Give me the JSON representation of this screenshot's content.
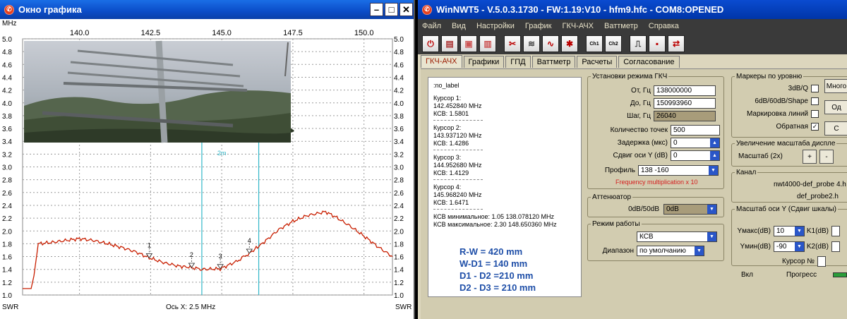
{
  "graph_window": {
    "title": "Окно графика",
    "x_unit": "MHz",
    "x_ticks": [
      "140.0",
      "142.5",
      "145.0",
      "147.5",
      "150.0"
    ],
    "y_ticks": [
      "5.0",
      "4.8",
      "4.6",
      "4.4",
      "4.2",
      "4.0",
      "3.8",
      "3.6",
      "3.4",
      "3.2",
      "3.0",
      "2.8",
      "2.6",
      "2.4",
      "2.2",
      "2.0",
      "1.8",
      "1.6",
      "1.4",
      "1.2",
      "1.0"
    ],
    "y_left_label": "SWR",
    "y_right_label": "SWR",
    "x_caption": "Ось X: 2.5 MHz",
    "marker_label": "2m",
    "cursor_labels": [
      "1",
      "2",
      "3",
      "4"
    ]
  },
  "chart_data": {
    "type": "line",
    "xlabel": "",
    "ylabel": "SWR",
    "xlim": [
      138.0,
      151.0
    ],
    "ylim": [
      1.0,
      5.0
    ],
    "grid": true,
    "series": [
      {
        "color": "#c81e00",
        "x": [
          138.0,
          138.3,
          138.4,
          138.55,
          139.0,
          139.5,
          140.0,
          140.5,
          141.0,
          141.5,
          142.0,
          142.45,
          143.0,
          143.5,
          143.94,
          144.3,
          144.95,
          145.5,
          145.97,
          146.5,
          147.0,
          147.5,
          148.0,
          148.65,
          149.0,
          149.5,
          150.0,
          150.5,
          151.0
        ],
        "y": [
          1.1,
          1.1,
          1.3,
          1.8,
          1.82,
          1.85,
          1.88,
          1.85,
          1.8,
          1.74,
          1.67,
          1.58,
          1.5,
          1.45,
          1.43,
          1.4,
          1.41,
          1.52,
          1.65,
          1.83,
          2.02,
          2.15,
          2.24,
          2.3,
          2.22,
          2.08,
          1.92,
          1.75,
          1.6
        ]
      }
    ],
    "cursors": [
      {
        "label": "1",
        "x": 142.45,
        "y": 1.58
      },
      {
        "label": "2",
        "x": 143.94,
        "y": 1.43
      },
      {
        "label": "3",
        "x": 144.95,
        "y": 1.41
      },
      {
        "label": "4",
        "x": 145.97,
        "y": 1.65
      }
    ],
    "vertical_markers": [
      144.3,
      146.3
    ]
  },
  "app": {
    "title": "WinNWT5 - V.5.0.3.1730 - FW:1.19:V10 - hfm9.hfc - COM8:OPENED",
    "menu": [
      "Файл",
      "Вид",
      "Настройки",
      "График",
      "ГКЧ-АЧХ",
      "Ваттметр",
      "Справка"
    ],
    "toolbar_icons": [
      "power-icon",
      "print-icon",
      "image-icon",
      "image-save-icon",
      "scissors-icon",
      "chart-icon",
      "sweep-icon",
      "tools-icon",
      "ch1-icon",
      "ch2-icon",
      "marker-icon",
      "save-icon",
      "swap-icon"
    ],
    "toolbar_text": {
      "ch1": "Ch1",
      "ch2": "Ch2"
    },
    "tabs": [
      "ГКЧ-АЧХ",
      "Графики",
      "ГПД",
      "Ваттметр",
      "Расчеты",
      "Согласование"
    ],
    "info": {
      "lines": [
        ":no_label",
        "",
        "Курсор 1:",
        "142.452840 MHz",
        "КСВ: 1.5801",
        "-",
        "Курсор 2:",
        "143.937120 MHz",
        "КСВ: 1.4286",
        "-",
        "Курсор 3:",
        "144.952680 MHz",
        "КСВ: 1.4129",
        "-",
        "Курсор 4:",
        "145.968240 MHz",
        "КСВ: 1.6471",
        "-",
        "КСВ минимальное: 1.05  138.078120 MHz",
        "КСВ максимальное: 2.30  148.650360 MHz"
      ],
      "dims": [
        "R-W = 420 mm",
        "W-D1 = 140 mm",
        "D1 - D2 =210 mm",
        "D2 - D3 = 210 mm"
      ]
    },
    "sweep": {
      "legend": "Установки режима ГКЧ",
      "from_label": "От, Гц",
      "from_value": "138000000",
      "to_label": "До, Гц",
      "to_value": "150993960",
      "step_label": "Шаг, Гц",
      "step_value": "26040",
      "points_label": "Количество точек",
      "points_value": "500",
      "delay_label": "Задержка (мкс)",
      "delay_value": "0",
      "yshift_label": "Сдвиг оси Y (dB)",
      "yshift_value": "0",
      "profile_label": "Профиль",
      "profile_value": "138 -160",
      "freq_note": "Frequency multiplication x 10"
    },
    "attenuator": {
      "legend": "Аттенюатор",
      "label": "0dB/50dB",
      "value": "0dB"
    },
    "mode": {
      "legend": "Режим работы",
      "mode_value": "КСВ",
      "range_label": "Диапазон",
      "range_value": "по умолчанию"
    },
    "markers": {
      "legend": "Маркеры по уровню",
      "items": [
        {
          "label": "3dB/Q",
          "checked": ""
        },
        {
          "label": "6dB/60dB/Shape",
          "checked": ""
        },
        {
          "label": "Маркировка линий",
          "checked": ""
        },
        {
          "label": "Обратная",
          "checked": "✓"
        }
      ],
      "btn1": "Много",
      "btn2": "Од",
      "btn3": "С"
    },
    "scale": {
      "legend": "Увеличение масштаба диспле",
      "label": "Масштаб (2x)",
      "plus": "+",
      "minus": "-"
    },
    "channel": {
      "legend": "Канал",
      "probe1": "nwt4000-def_probe 4.h",
      "probe2": "def_probe2.h"
    },
    "yaxis": {
      "legend": "Масштаб оси Y (Сдвиг шкалы)",
      "ymax_label": "Yмакс(dB)",
      "ymax_value": "10",
      "ymin_label": "Yмин(dB)",
      "ymin_value": "-90",
      "k1_label": "K1(dB)",
      "k2_label": "K2(dB)",
      "cursor_label": "Курсор №"
    },
    "bottom": {
      "on_label": "Вкл",
      "progress_label": "Прогресс"
    }
  }
}
